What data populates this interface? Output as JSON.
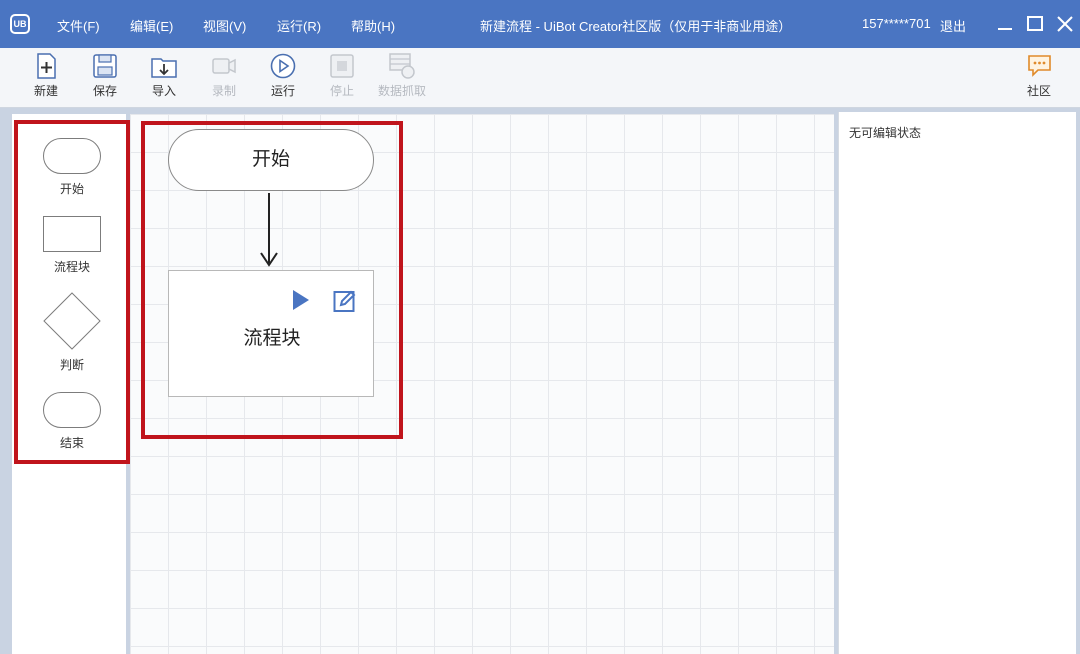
{
  "app": {
    "logo": "UB",
    "title": "新建流程 - UiBot Creator社区版（仅用于非商业用途）",
    "account": "157*****701",
    "logout": "退出"
  },
  "menu": [
    "文件(F)",
    "编辑(E)",
    "视图(V)",
    "运行(R)",
    "帮助(H)"
  ],
  "toolbar": {
    "new": "新建",
    "save": "保存",
    "import": "导入",
    "record": "录制",
    "run": "运行",
    "stop": "停止",
    "scrape": "数据抓取",
    "community": "社区"
  },
  "palette": {
    "start": "开始",
    "block": "流程块",
    "decision": "判断",
    "end": "结束"
  },
  "canvas": {
    "start_label": "开始",
    "block_label": "流程块"
  },
  "properties": {
    "status": "无可编辑状态"
  },
  "colors": {
    "titlebar": "#4a75c2",
    "highlight": "#c0141c",
    "accent": "#4a75c2"
  }
}
